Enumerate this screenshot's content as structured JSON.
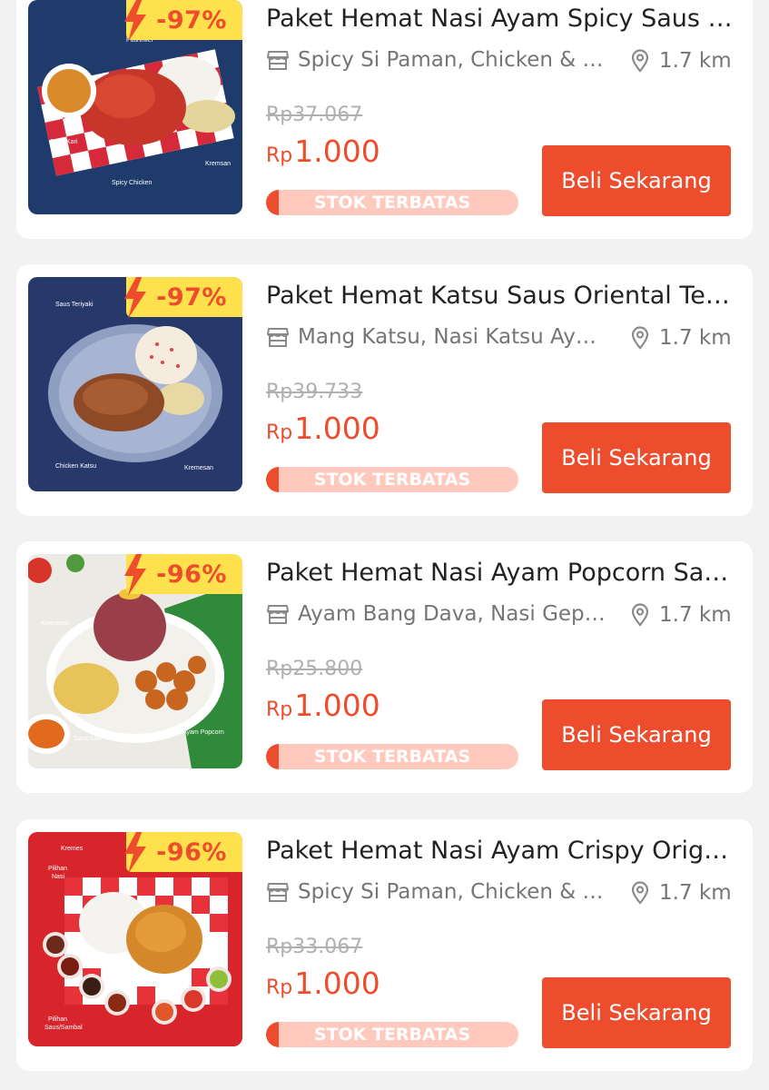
{
  "colors": {
    "accent": "#ee4d2d",
    "badge": "#ffe14d",
    "stock_bg": "#ffc9bd"
  },
  "products": [
    {
      "discount": "-97%",
      "title": "Paket Hemat Nasi Ayam Spicy Saus Kari",
      "shop": "Spicy Si Paman, Chicken & Rice",
      "distance": "1.7 km",
      "original_price": "Rp37.067",
      "currency": "Rp",
      "price": "1.000",
      "stock_label": "STOK TERBATAS",
      "stock_level": 0.05,
      "buy_label": "Beli Sekarang",
      "image_labels": [
        "Pilihan Putih/Merah",
        "Saus Kari",
        "Spicy Chicken",
        "Kremsan"
      ]
    },
    {
      "discount": "-97%",
      "title": "Paket Hemat Katsu Saus Oriental Teriyaki",
      "shop": "Mang Katsu, Nasi Katsu Ayam",
      "distance": "1.7 km",
      "original_price": "Rp39.733",
      "currency": "Rp",
      "price": "1.000",
      "stock_label": "STOK TERBATAS",
      "stock_level": 0.05,
      "buy_label": "Beli Sekarang",
      "image_labels": [
        "Saus Teriyaki",
        "Chicken Katsu",
        "Kremesan"
      ]
    },
    {
      "discount": "-96%",
      "title": "Paket Hemat Nasi Ayam Popcorn Saus Kari",
      "shop": "Ayam Bang Dava, Nasi Geprek",
      "distance": "1.7 km",
      "original_price": "Rp25.800",
      "currency": "Rp",
      "price": "1.000",
      "stock_label": "STOK TERBATAS",
      "stock_level": 0.05,
      "buy_label": "Beli Sekarang",
      "image_labels": [
        "Kremesan",
        "Saus Kari",
        "Ayam Popcorn"
      ]
    },
    {
      "discount": "-96%",
      "title": "Paket Hemat Nasi Ayam Crispy Original",
      "shop": "Spicy Si Paman, Chicken & Rice",
      "distance": "1.7 km",
      "original_price": "Rp33.067",
      "currency": "Rp",
      "price": "1.000",
      "stock_label": "STOK TERBATAS",
      "stock_level": 0.05,
      "buy_label": "Beli Sekarang",
      "image_labels": [
        "Kremes",
        "Pilihan Nasi",
        "Pilihan Saus/Sambal"
      ]
    }
  ]
}
